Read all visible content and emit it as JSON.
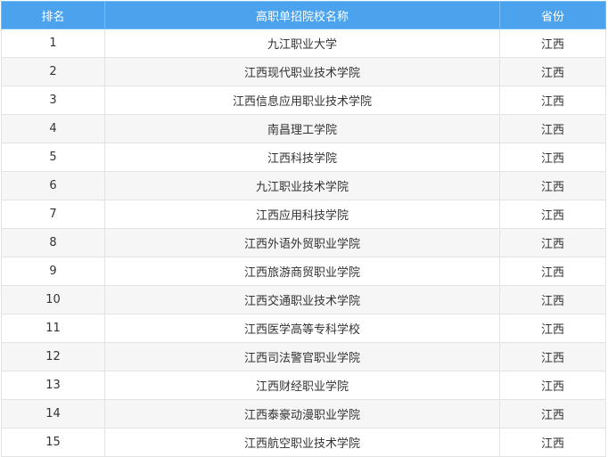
{
  "table": {
    "headers": {
      "rank": "排名",
      "name": "高职单招院校名称",
      "province": "省份"
    },
    "rows": [
      {
        "rank": "1",
        "name": "九江职业大学",
        "province": "江西"
      },
      {
        "rank": "2",
        "name": "江西现代职业技术学院",
        "province": "江西"
      },
      {
        "rank": "3",
        "name": "江西信息应用职业技术学院",
        "province": "江西"
      },
      {
        "rank": "4",
        "name": "南昌理工学院",
        "province": "江西"
      },
      {
        "rank": "5",
        "name": "江西科技学院",
        "province": "江西"
      },
      {
        "rank": "6",
        "name": "九江职业技术学院",
        "province": "江西"
      },
      {
        "rank": "7",
        "name": "江西应用科技学院",
        "province": "江西"
      },
      {
        "rank": "8",
        "name": "江西外语外贸职业学院",
        "province": "江西"
      },
      {
        "rank": "9",
        "name": "江西旅游商贸职业学院",
        "province": "江西"
      },
      {
        "rank": "10",
        "name": "江西交通职业技术学院",
        "province": "江西"
      },
      {
        "rank": "11",
        "name": "江西医学高等专科学校",
        "province": "江西"
      },
      {
        "rank": "12",
        "name": "江西司法警官职业学院",
        "province": "江西"
      },
      {
        "rank": "13",
        "name": "江西财经职业学院",
        "province": "江西"
      },
      {
        "rank": "14",
        "name": "江西泰豪动漫职业学院",
        "province": "江西"
      },
      {
        "rank": "15",
        "name": "江西航空职业技术学院",
        "province": "江西"
      }
    ]
  },
  "colors": {
    "header_bg": "#4ba3ee",
    "header_text": "#ffffff",
    "row_alt_bg": "#f6f6f6",
    "border": "#e3e3e3",
    "cell_text": "#333333"
  }
}
